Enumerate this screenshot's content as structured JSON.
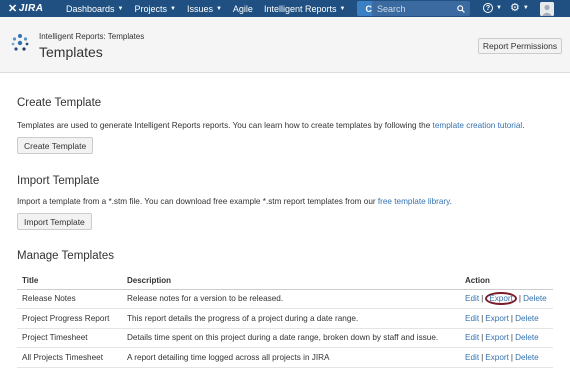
{
  "nav": {
    "logo": "JIRA",
    "items": [
      {
        "label": "Dashboards",
        "dropdown": true,
        "name": "nav-dashboards"
      },
      {
        "label": "Projects",
        "dropdown": true,
        "name": "nav-projects"
      },
      {
        "label": "Issues",
        "dropdown": true,
        "name": "nav-issues"
      },
      {
        "label": "Agile",
        "dropdown": false,
        "name": "nav-agile"
      },
      {
        "label": "Intelligent Reports",
        "dropdown": true,
        "name": "nav-intelligent-reports"
      }
    ],
    "create_label": "Create",
    "search_placeholder": "Search",
    "bar_color": "#205081"
  },
  "header": {
    "breadcrumb": "Intelligent Reports: Templates",
    "title": "Templates",
    "permissions_button": "Report Permissions"
  },
  "create_section": {
    "title": "Create Template",
    "desc": "Templates are used to generate Intelligent Reports reports. You can learn how to create templates by following the",
    "link": "template creation tutorial",
    "desc_end": ".",
    "button": "Create Template"
  },
  "import_section": {
    "title": "Import Template",
    "desc": "Import a template from a *.stm file. You can download free example *.stm report templates from our",
    "link": "free template library",
    "desc_end": ".",
    "button": "Import Template"
  },
  "manage_section": {
    "title": "Manage Templates",
    "columns": [
      "Title",
      "Description",
      "Action"
    ],
    "rows": [
      {
        "title": "Release Notes",
        "description": "Release notes for a version to be released."
      },
      {
        "title": "Project Progress Report",
        "description": "This report details the progress of a project during a date range."
      },
      {
        "title": "Project Timesheet",
        "description": "Details time spent on this project during a date range, broken down by staff and issue."
      },
      {
        "title": "All Projects Timesheet",
        "description": "A report detailing time logged across all projects in JIRA"
      }
    ],
    "actions": {
      "edit": "Edit",
      "export": "Export",
      "delete": "Delete",
      "separator": "|"
    }
  }
}
